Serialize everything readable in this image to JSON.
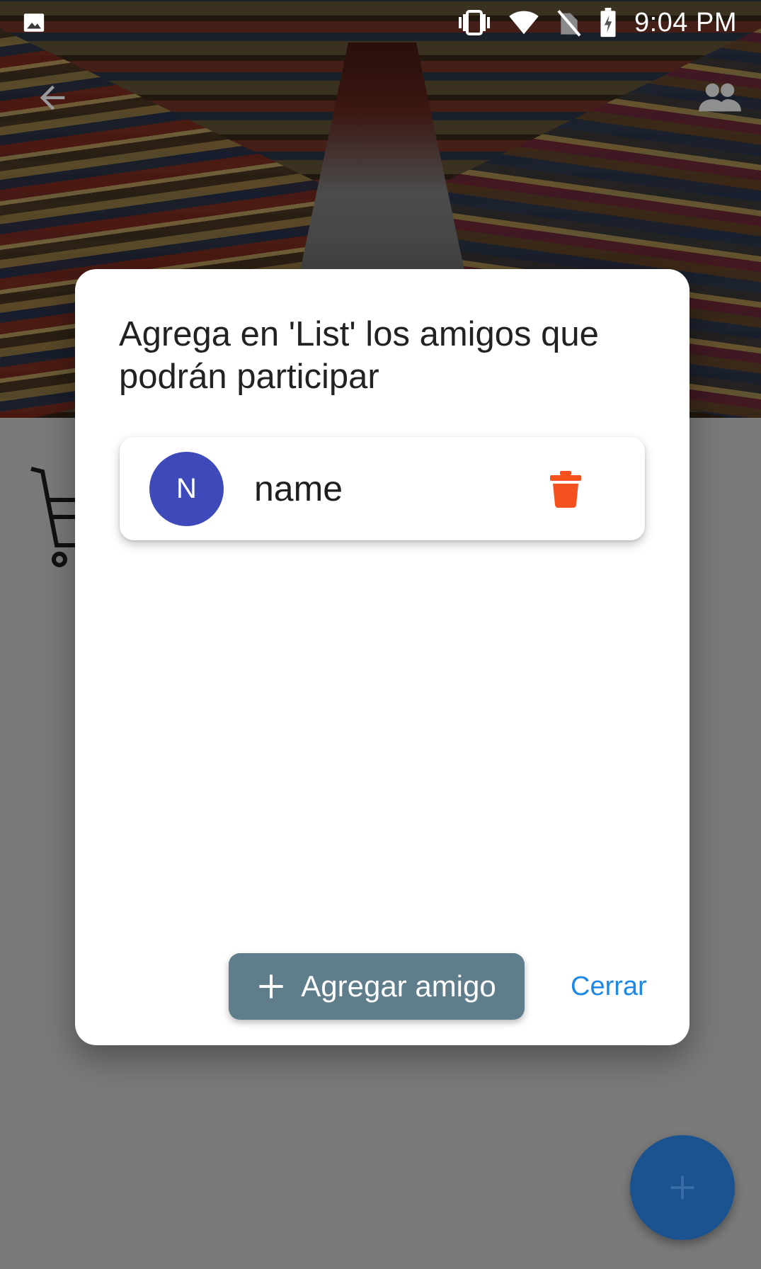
{
  "status_bar": {
    "time": "9:04 PM",
    "icons": [
      "image-icon",
      "vibrate-icon",
      "wifi-icon",
      "no-sim-icon",
      "battery-charging-icon"
    ]
  },
  "app_bar": {
    "icons": [
      "back-arrow-icon",
      "people-icon"
    ]
  },
  "background": {
    "icons": [
      "shopping-cart-icon"
    ],
    "fab_icon": "plus-icon"
  },
  "dialog": {
    "title": "Agrega en 'List' los amigos que podrán participar",
    "friends": [
      {
        "initial": "N",
        "name": "name",
        "avatar_color": "#3f4aba",
        "action_icon": "trash-icon",
        "action_color": "#f4511e"
      }
    ],
    "add_button_label": "Agregar amigo",
    "add_button_icon": "plus-icon",
    "close_button_label": "Cerrar"
  },
  "colors": {
    "fab": "#1a5390",
    "add_button": "#607d8b",
    "close_link": "#1e88e5"
  }
}
